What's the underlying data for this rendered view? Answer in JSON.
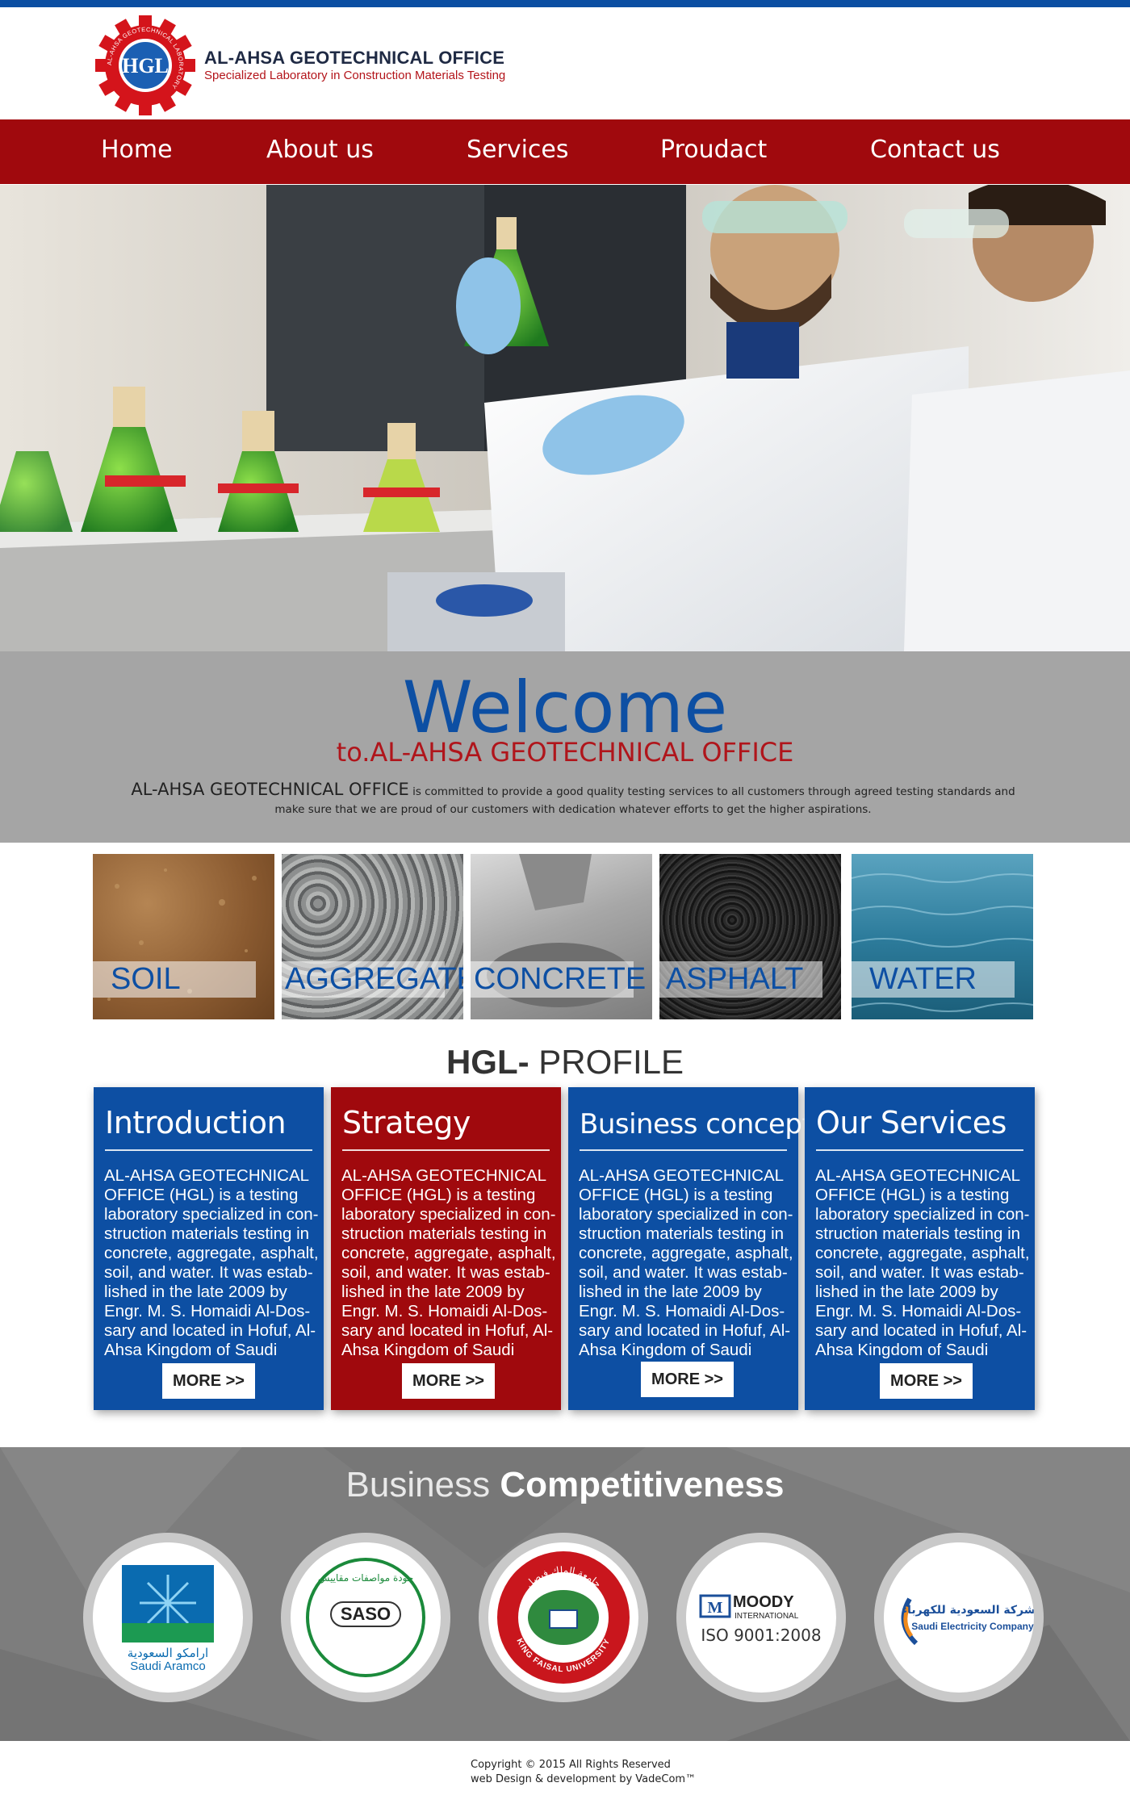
{
  "header": {
    "title": "AL-AHSA GEOTECHNICAL OFFICE",
    "subtitle": "Specialized Laboratory in Construction Materials Testing",
    "logo_letters": "HGL",
    "logo_ring_text": "AL-AHSA GEOTECHNICAL LABORATORY"
  },
  "nav": {
    "items": [
      {
        "label": "Home"
      },
      {
        "label": "About us"
      },
      {
        "label": "Services"
      },
      {
        "label": "Proudact"
      },
      {
        "label": "Contact us"
      }
    ]
  },
  "welcome": {
    "title": "Welcome",
    "subtitle": "to.AL-AHSA GEOTECHNICAL OFFICE",
    "lead": "AL-AHSA GEOTECHNICAL OFFICE",
    "text": "is committed to provide a good quality testing services to all customers through agreed testing standards and make sure that we are proud of our customers with dedication whatever efforts to get the higher aspirations."
  },
  "materials": [
    {
      "label": "SOIL"
    },
    {
      "label": "AGGREGATE"
    },
    {
      "label": "CONCRETE"
    },
    {
      "label": "ASPHALT"
    },
    {
      "label": "WATER"
    }
  ],
  "profile": {
    "title_bold": "HGL-",
    "title_rest": "PROFILE",
    "cards": [
      {
        "title": "Introduction",
        "body": "AL-AHSA GEOTECHNICAL OFFICE (HGL) is a testing laboratory specialized in con-struction materials testing in concrete, aggregate, asphalt, soil, and water. It was estab-lished in the late 2009 by Engr. M. S. Homaidi Al-Dos-sary and located in Hofuf, Al-Ahsa Kingdom of Saudi",
        "button": "MORE >>"
      },
      {
        "title": "Strategy",
        "body": "AL-AHSA GEOTECHNICAL OFFICE (HGL) is a testing laboratory specialized in con-struction materials testing in concrete, aggregate, asphalt, soil, and water. It was estab-lished in the late 2009 by Engr. M. S. Homaidi Al-Dos-sary and located in Hofuf, Al-Ahsa Kingdom of Saudi",
        "button": "MORE >>"
      },
      {
        "title": "Business concept",
        "body": "AL-AHSA GEOTECHNICAL OFFICE (HGL) is a testing laboratory specialized in con-struction materials testing in concrete, aggregate, asphalt, soil, and water. It was estab-lished in the late 2009 by Engr. M. S. Homaidi Al-Dos-sary and located in Hofuf, Al-Ahsa Kingdom of Saudi",
        "button": "MORE >>"
      },
      {
        "title": "Our Services",
        "body": "AL-AHSA GEOTECHNICAL OFFICE (HGL) is a testing laboratory specialized in con-struction materials testing in concrete, aggregate, asphalt, soil, and water. It was estab-lished in the late 2009 by Engr. M. S. Homaidi Al-Dos-sary and located in Hofuf, Al-Ahsa Kingdom of Saudi",
        "button": "MORE >>"
      }
    ]
  },
  "business": {
    "title_light": "Business",
    "title_bold": "Competitiveness",
    "partners": [
      {
        "name": "Saudi Aramco",
        "arabic": "ارامكو السعودية"
      },
      {
        "name": "SASO",
        "arabic": "جودة مواصفات مقاييس"
      },
      {
        "name": "KING FAISAL UNIVERSITY",
        "arabic": "جامعة الملك فيصل"
      },
      {
        "name": "MOODY",
        "sub": "INTERNATIONAL",
        "cert": "ISO 9001:2008"
      },
      {
        "name": "Saudi Electricity Company",
        "arabic": "الشركة السعودية للكهرباء"
      }
    ]
  },
  "footer": {
    "line1": "Copyright © 2015 All Rights Reserved",
    "line2": "web Design & development by VadeCom™"
  },
  "colors": {
    "brand_blue": "#0d4fa3",
    "brand_red": "#a0090d",
    "welcome_bg": "#a5a5a5",
    "business_bg": "#7d7d7d"
  }
}
